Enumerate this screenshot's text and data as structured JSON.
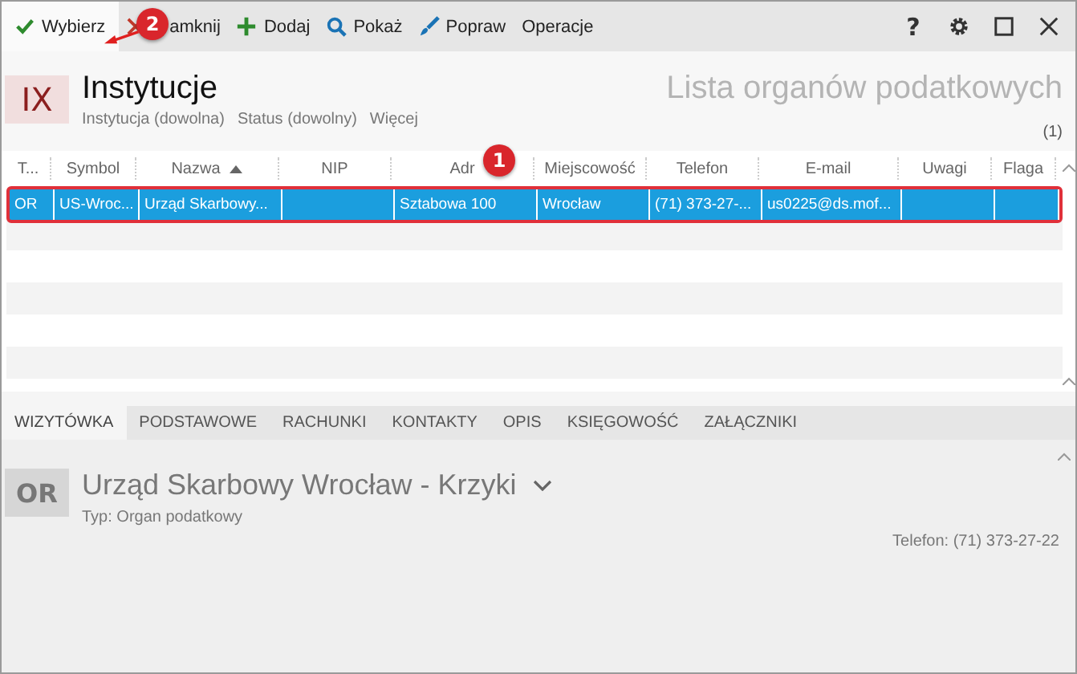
{
  "toolbar": {
    "items": [
      {
        "kind": "check",
        "label": "Wybierz"
      },
      {
        "kind": "close",
        "label": "amknij"
      },
      {
        "kind": "plus",
        "label": "Dodaj"
      },
      {
        "kind": "search",
        "label": "Pokaż"
      },
      {
        "kind": "brush",
        "label": "Popraw"
      },
      {
        "kind": "none",
        "label": "Operacje"
      }
    ],
    "window_buttons": [
      {
        "kind": "help",
        "label": "?"
      },
      {
        "kind": "gear"
      },
      {
        "kind": "maximize"
      },
      {
        "kind": "close"
      }
    ]
  },
  "header": {
    "badge": "IX",
    "title": "Instytucje",
    "filters": [
      "Instytucja (dowolna)",
      "Status (dowolny)",
      "Więcej"
    ],
    "subtitle": "Lista organów podatkowych",
    "count": "(1)"
  },
  "table": {
    "columns": [
      {
        "label": "T..."
      },
      {
        "label": "Symbol"
      },
      {
        "label": "Nazwa",
        "sorted": true
      },
      {
        "label": "NIP"
      },
      {
        "label": "Adr"
      },
      {
        "label": "Miejscowość"
      },
      {
        "label": "Telefon"
      },
      {
        "label": "E-mail"
      },
      {
        "label": "Uwagi"
      },
      {
        "label": "Flaga"
      }
    ],
    "rows": [
      {
        "selected": true,
        "cells": [
          "OR",
          "US-Wroc...",
          "Urząd Skarbowy...",
          "",
          "Sztabowa 100",
          "Wrocław",
          "(71) 373-27-...",
          "us0225@ds.mof...",
          "",
          ""
        ]
      }
    ]
  },
  "tabs": [
    {
      "label": "WIZYTÓWKA",
      "selected": true
    },
    {
      "label": "PODSTAWOWE",
      "selected": false
    },
    {
      "label": "RACHUNKI",
      "selected": false
    },
    {
      "label": "KONTAKTY",
      "selected": false
    },
    {
      "label": "OPIS",
      "selected": false
    },
    {
      "label": "KSIĘGOWOŚĆ",
      "selected": false
    },
    {
      "label": "ZAŁĄCZNIKI",
      "selected": false
    }
  ],
  "detail": {
    "badge": "OR",
    "name": "Urząd Skarbowy Wrocław - Krzyki",
    "type": "Typ: Organ podatkowy",
    "phone": "Telefon: (71) 373-27-22"
  },
  "annotations": [
    {
      "label": "1",
      "pointer": false
    },
    {
      "label": "2",
      "pointer": true
    }
  ]
}
